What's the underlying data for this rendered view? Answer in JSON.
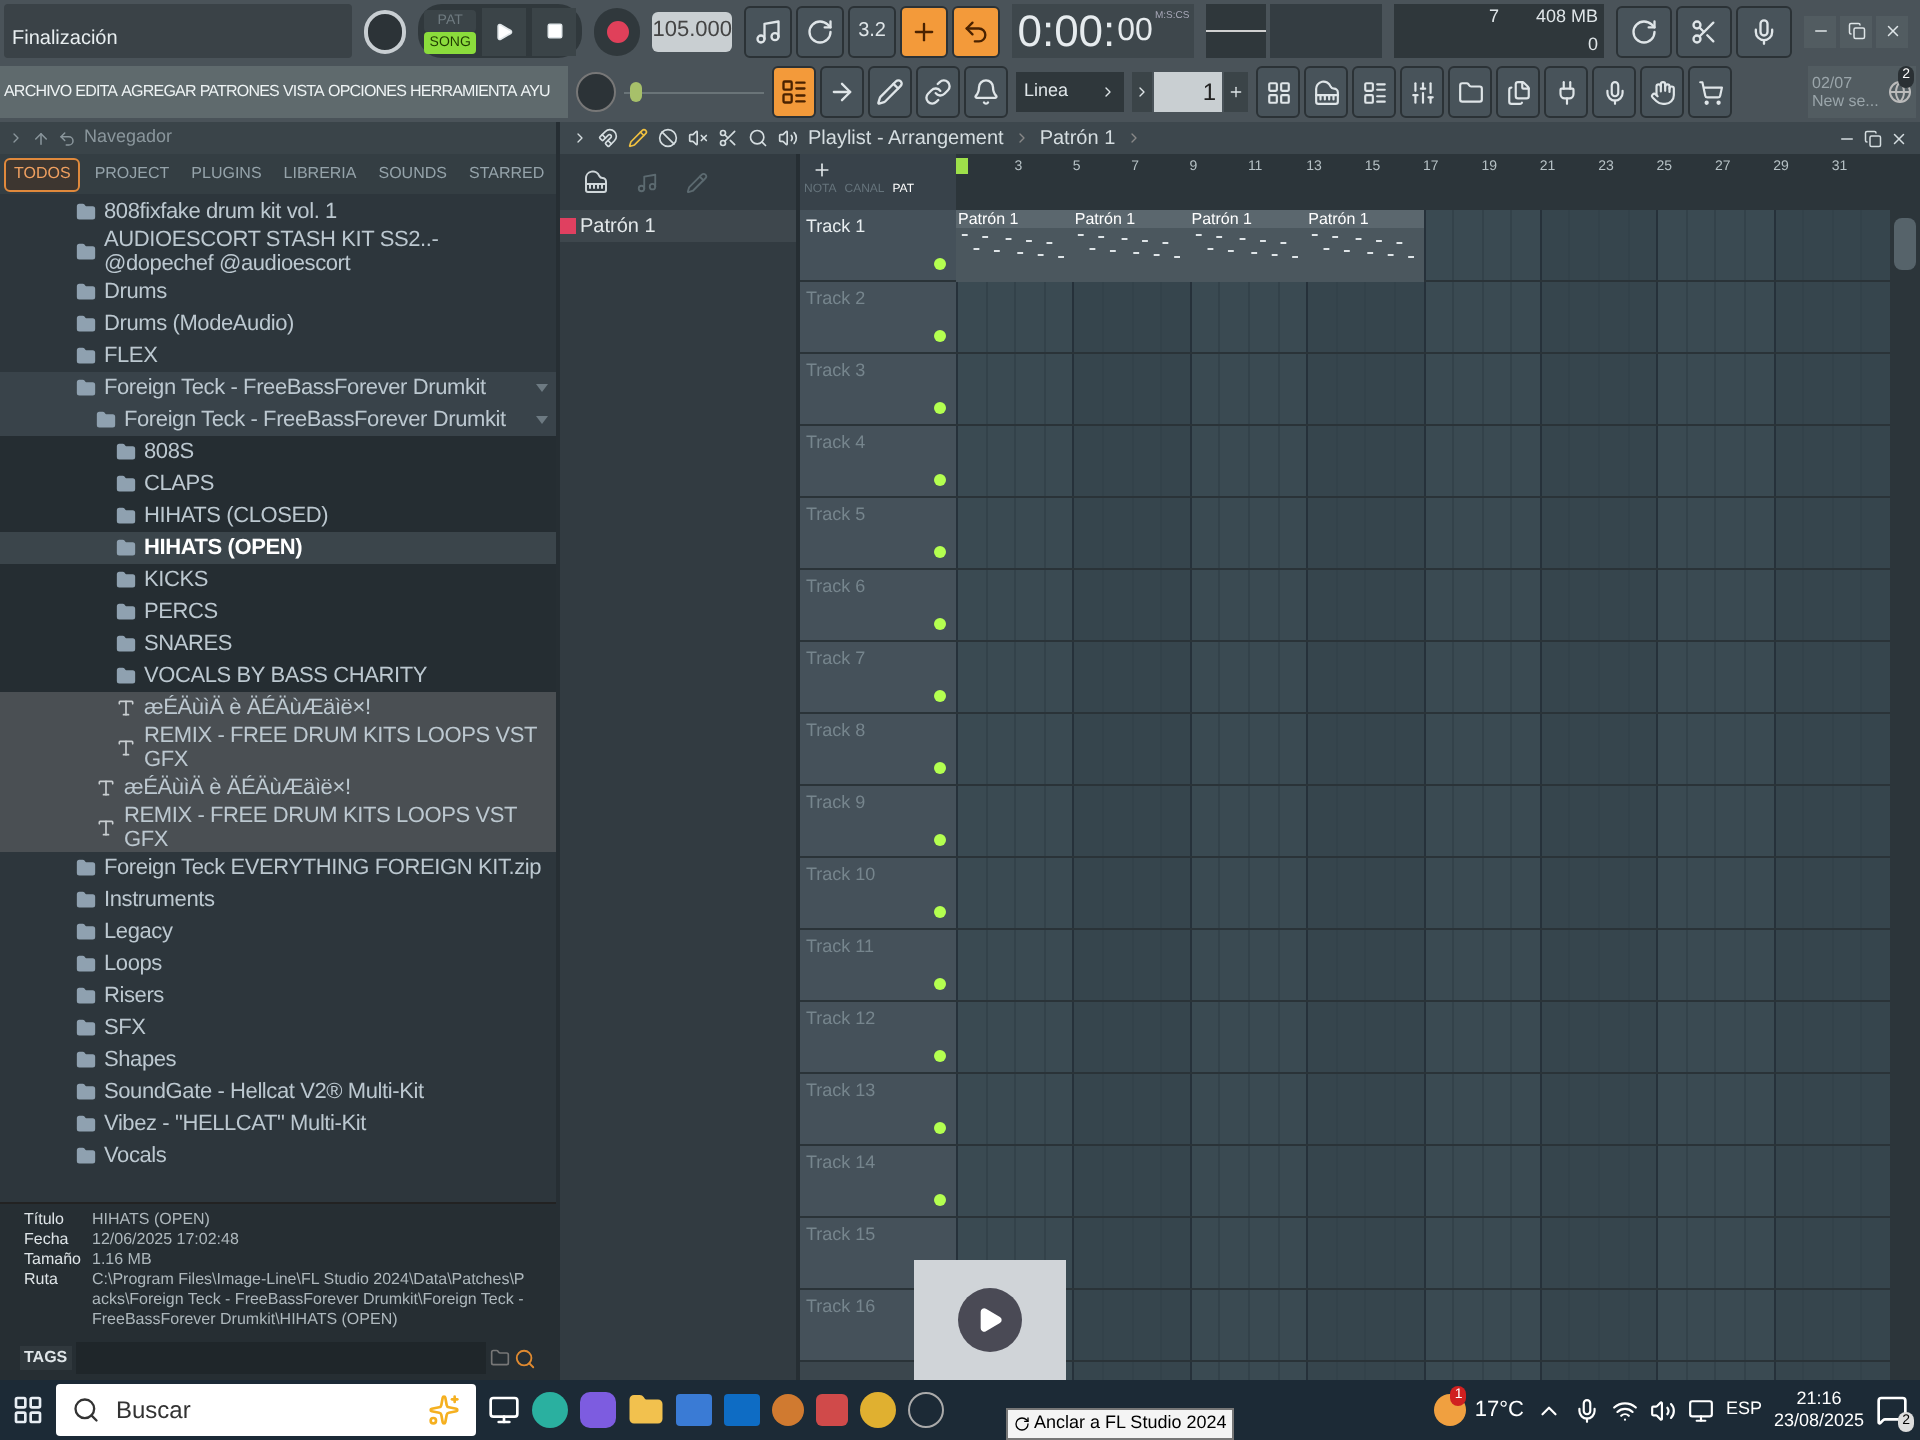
{
  "hint_bar": {
    "text": "Finalización"
  },
  "transport": {
    "modes": [
      {
        "label": "PAT",
        "selected": false
      },
      {
        "label": "SONG",
        "selected": true
      }
    ],
    "recording": false,
    "tempo": "105.000"
  },
  "top_tools": [
    {
      "kind": "icon",
      "on": false
    },
    {
      "kind": "icon",
      "on": false
    },
    {
      "kind": "text",
      "label": "3.2",
      "on": false
    },
    {
      "kind": "icon",
      "on": true
    },
    {
      "kind": "icon",
      "on": true
    }
  ],
  "time": {
    "main": "0:00:",
    "small": "00",
    "unit": "M:S:CS"
  },
  "monitor": {
    "cpu": "7",
    "memory": "408 MB",
    "polyphony": "0"
  },
  "menu": [
    "ARCHIVO",
    "EDITA",
    "AGREGAR",
    "PATRONES",
    "VISTA",
    "OPCIONES",
    "HERRAMIENTA",
    "AYU"
  ],
  "main_volume": {
    "level": 0.05
  },
  "edit_tools": [
    {
      "on": true
    },
    {
      "on": false
    },
    {
      "on": false
    },
    {
      "on": false
    },
    {
      "on": false
    }
  ],
  "snap": {
    "value": "Linea"
  },
  "pattern_selector": {
    "value": "1"
  },
  "news": {
    "date": "02/07",
    "text": "New se...",
    "badge": "2"
  },
  "browser": {
    "title": "Navegador",
    "tabs": [
      {
        "label": "TODOS",
        "selected": true
      },
      {
        "label": "PROJECT",
        "selected": false
      },
      {
        "label": "PLUGINS",
        "selected": false
      },
      {
        "label": "LIBRERIA",
        "selected": false
      },
      {
        "label": "SOUNDS",
        "selected": false
      },
      {
        "label": "STARRED",
        "selected": false
      }
    ],
    "tree": [
      {
        "name": "808fixfake drum kit vol. 1",
        "kind": "folder",
        "selected": false
      },
      {
        "name": "AUDIOESCORT STASH KIT SS2..- @dopechef @audioescort",
        "kind": "folder",
        "selected": false
      },
      {
        "name": "Drums",
        "kind": "folder",
        "selected": false
      },
      {
        "name": "Drums (ModeAudio)",
        "kind": "folder",
        "selected": false
      },
      {
        "name": "FLEX",
        "kind": "folder",
        "selected": false
      },
      {
        "name": "Foreign Teck - FreeBassForever Drumkit",
        "kind": "folder",
        "selected": false,
        "expanded": true,
        "children": [
          {
            "name": "Foreign Teck - FreeBassForever Drumkit",
            "kind": "folder",
            "selected": false,
            "expanded": true,
            "children": [
              {
                "name": "808S",
                "kind": "folder",
                "selected": false
              },
              {
                "name": "CLAPS",
                "kind": "folder",
                "selected": false
              },
              {
                "name": "HIHATS (CLOSED)",
                "kind": "folder",
                "selected": false
              },
              {
                "name": "HIHATS (OPEN)",
                "kind": "folder",
                "selected": true
              },
              {
                "name": "KICKS",
                "kind": "folder",
                "selected": false
              },
              {
                "name": "PERCS",
                "kind": "folder",
                "selected": false
              },
              {
                "name": "SNARES",
                "kind": "folder",
                "selected": false
              },
              {
                "name": "VOCALS BY BASS CHARITY",
                "kind": "folder",
                "selected": false
              },
              {
                "name": "æÉÄùìÄ è ÄÉÄùÆäìë×!",
                "kind": "file",
                "selected": false
              },
              {
                "name": "REMIX - FREE DRUM KITS LOOPS VST GFX",
                "kind": "file",
                "selected": false
              }
            ]
          },
          {
            "name": "æÉÄùìÄ è ÄÉÄùÆäìë×!",
            "kind": "file",
            "selected": false
          },
          {
            "name": "REMIX - FREE DRUM KITS LOOPS VST GFX",
            "kind": "file",
            "selected": false
          }
        ]
      },
      {
        "name": "Foreign Teck EVERYTHING FOREIGN KIT.zip",
        "kind": "folder",
        "selected": false
      },
      {
        "name": "Instruments",
        "kind": "folder",
        "selected": false
      },
      {
        "name": "Legacy",
        "kind": "folder",
        "selected": false
      },
      {
        "name": "Loops",
        "kind": "folder",
        "selected": false
      },
      {
        "name": "Risers",
        "kind": "folder",
        "selected": false
      },
      {
        "name": "SFX",
        "kind": "folder",
        "selected": false
      },
      {
        "name": "Shapes",
        "kind": "folder",
        "selected": false
      },
      {
        "name": "SoundGate - Hellcat V2® Multi-Kit",
        "kind": "folder",
        "selected": false
      },
      {
        "name": "Vibez - \"HELLCAT\" Multi-Kit",
        "kind": "folder",
        "selected": false
      },
      {
        "name": "Vocals",
        "kind": "folder",
        "selected": false
      }
    ],
    "info": [
      {
        "label": "Título",
        "value": "HIHATS (OPEN)"
      },
      {
        "label": "Fecha",
        "value": "12/06/2025 17:02:48"
      },
      {
        "label": "Tamaño",
        "value": "1.16 MB"
      },
      {
        "label": "Ruta",
        "value": "C:\\Program Files\\Image-Line\\FL Studio 2024\\Data\\Patches\\Packs\\Foreign Teck - FreeBassForever Drumkit\\Foreign Teck - FreeBassForever Drumkit\\HIHATS (OPEN)"
      }
    ],
    "tags_label": "TAGS"
  },
  "playlist": {
    "title": "Playlist - Arrangement",
    "pattern": "Patrón 1",
    "column_labels": [
      "NOTA",
      "CANAL",
      "PAT"
    ],
    "patterns": [
      {
        "name": "Patrón 1",
        "selected": true
      }
    ],
    "ruler": [
      "3",
      "5",
      "7",
      "9",
      "11",
      "13",
      "15",
      "17",
      "19",
      "21",
      "23",
      "25",
      "27",
      "29",
      "31"
    ],
    "tracks": [
      {
        "name": "Track 1",
        "filled": true
      },
      {
        "name": "Track 2",
        "filled": false
      },
      {
        "name": "Track 3",
        "filled": false
      },
      {
        "name": "Track 4",
        "filled": false
      },
      {
        "name": "Track 5",
        "filled": false
      },
      {
        "name": "Track 6",
        "filled": false
      },
      {
        "name": "Track 7",
        "filled": false
      },
      {
        "name": "Track 8",
        "filled": false
      },
      {
        "name": "Track 9",
        "filled": false
      },
      {
        "name": "Track 10",
        "filled": false
      },
      {
        "name": "Track 11",
        "filled": false
      },
      {
        "name": "Track 12",
        "filled": false
      },
      {
        "name": "Track 13",
        "filled": false
      },
      {
        "name": "Track 14",
        "filled": false
      },
      {
        "name": "Track 15",
        "filled": false
      },
      {
        "name": "Track 16",
        "filled": false
      }
    ],
    "clips": [
      "Patrón 1",
      "Patrón 1",
      "Patrón 1",
      "Patrón 1"
    ]
  },
  "taskbar": {
    "search_placeholder": "Buscar",
    "weather": {
      "temp": "17°C",
      "badge": "1"
    },
    "language": "ESP",
    "time": "21:16",
    "date": "23/08/2025",
    "notifications": "2",
    "tooltip": "Anclar a FL Studio 2024"
  }
}
